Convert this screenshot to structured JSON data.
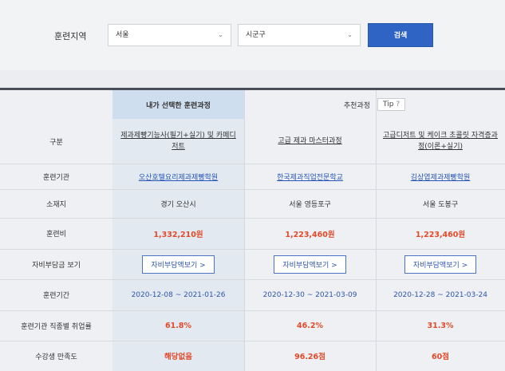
{
  "search": {
    "label": "훈련지역",
    "region": {
      "selected": "서울"
    },
    "district": {
      "selected": "시군구"
    },
    "button": "검색"
  },
  "compare": {
    "header_mine": "내가 선택한 훈련과정",
    "header_recommend": "추천과정",
    "tip_label": "Tip",
    "tip_icon": "?",
    "row_labels": {
      "category": "구분",
      "institution": "훈련기관",
      "location": "소재지",
      "fee": "훈련비",
      "copay": "자비부담금 보기",
      "period": "훈련기간",
      "employment": "훈련기관 직종별 취업률",
      "satisfaction": "수강생 만족도"
    },
    "courses": [
      {
        "name": "제과제빵기능사(필기+실기) 및 카페디저트",
        "institution": "오산호텔요리제과제빵학원",
        "location": "경기 오산시",
        "fee": "1,332,210원",
        "copay_button": "자비부담액보기 >",
        "period": "2020-12-08 ~ 2021-01-26",
        "employment": "61.8%",
        "satisfaction": "해당없음"
      },
      {
        "name": "고급 제과 마스터과정",
        "institution": "한국제과직업전문학교",
        "location": "서울 영등포구",
        "fee": "1,223,460원",
        "copay_button": "자비부담액보기 >",
        "period": "2020-12-30 ~ 2021-03-09",
        "employment": "46.2%",
        "satisfaction": "96.26점"
      },
      {
        "name": "고급디저트 및 케이크 초콜릿 자격증과정(이론+실기)",
        "institution": "김상엽제과제빵학원",
        "location": "서울 도봉구",
        "fee": "1,223,460원",
        "copay_button": "자비부담액보기 >",
        "period": "2020-12-28 ~ 2021-03-24",
        "employment": "31.3%",
        "satisfaction": "60점"
      }
    ]
  }
}
